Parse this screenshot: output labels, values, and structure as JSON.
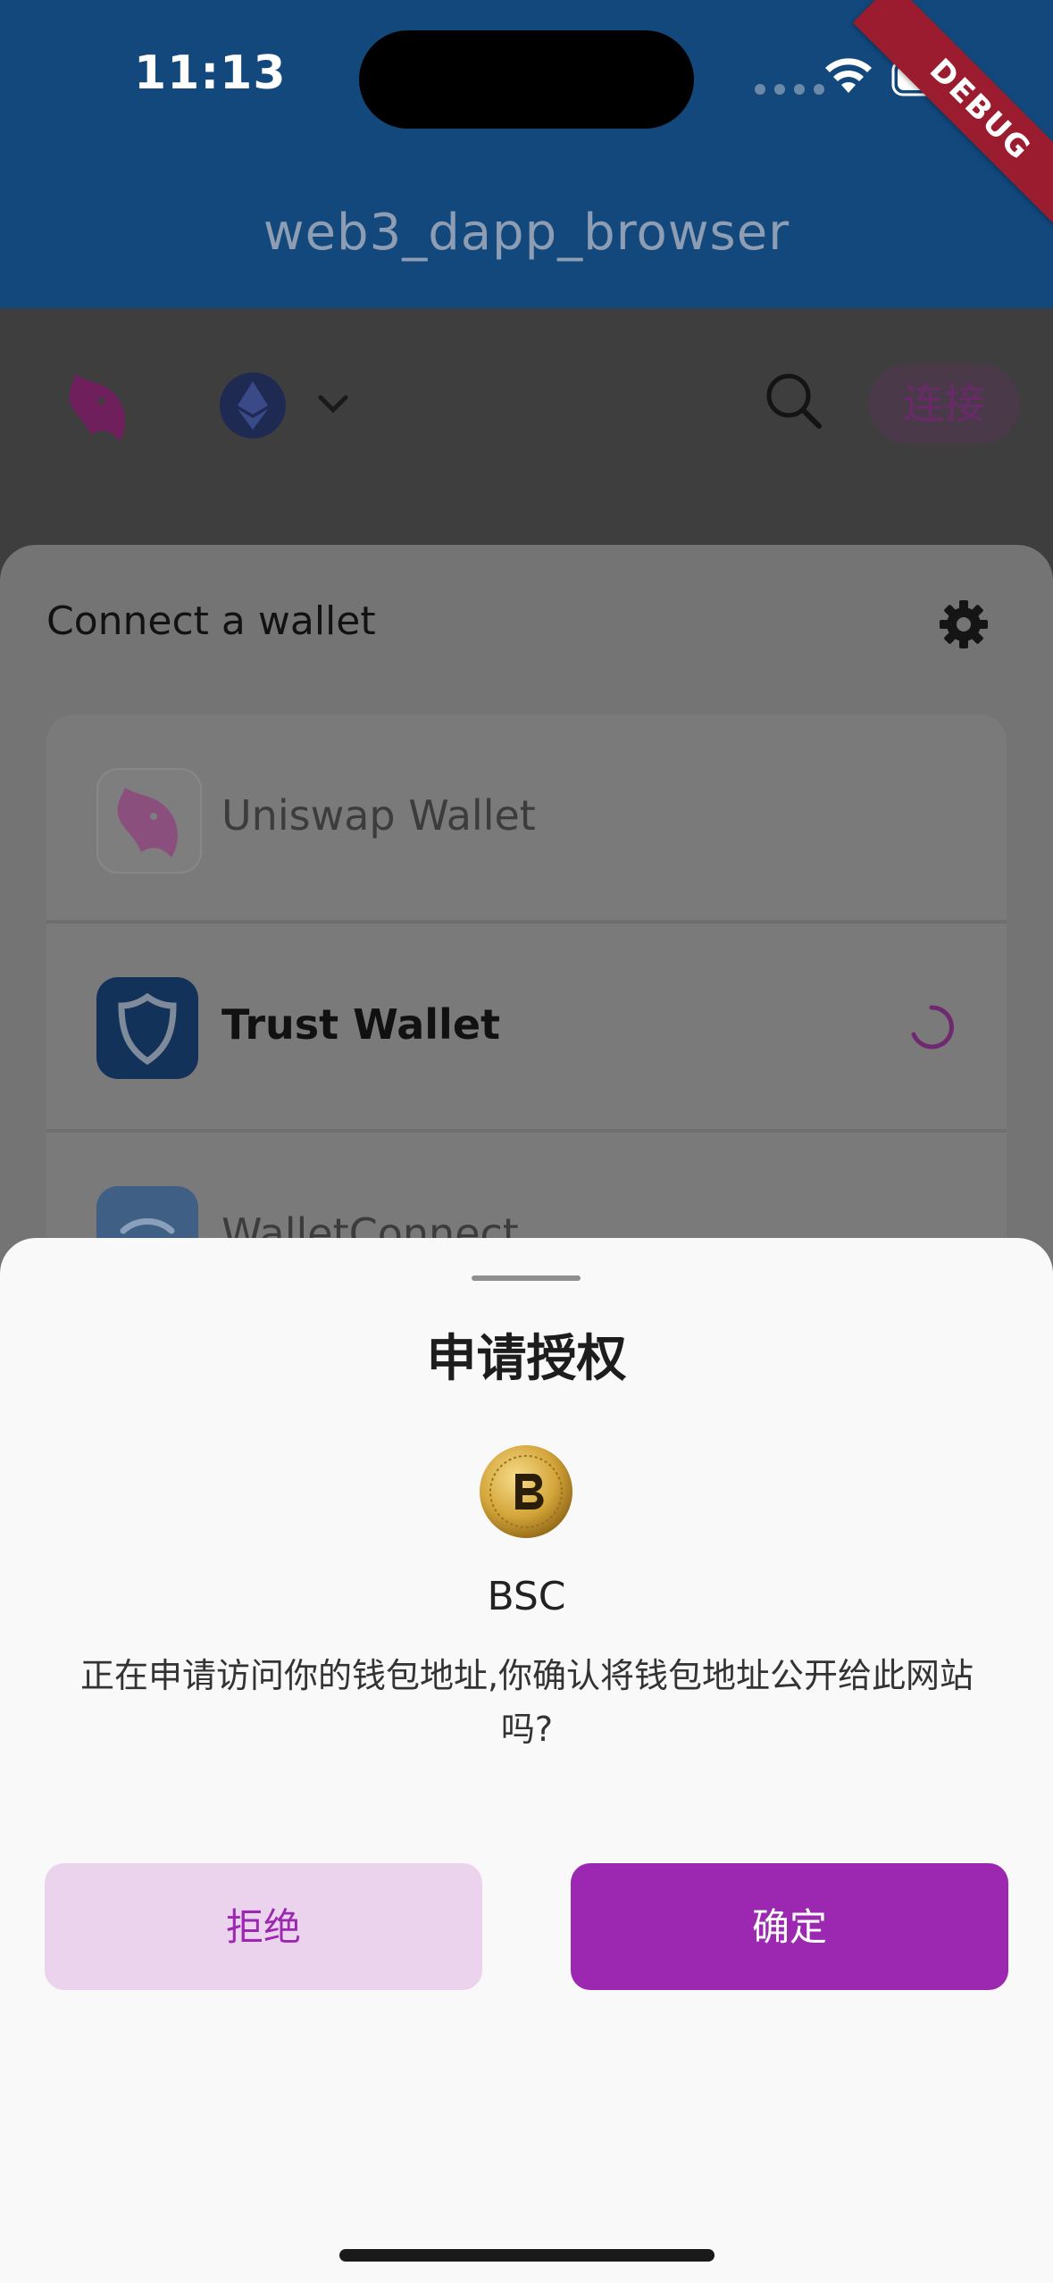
{
  "status_bar": {
    "time": "11:13"
  },
  "debug_banner": "DEBUG",
  "app_bar": {
    "title": "web3_dapp_browser"
  },
  "web_header": {
    "connect_label": "连接"
  },
  "wallet_panel": {
    "title": "Connect a wallet",
    "wallets": [
      {
        "name": "Uniswap Wallet",
        "icon": "uniswap-unicorn-icon"
      },
      {
        "name": "Trust Wallet",
        "icon": "trust-shield-icon",
        "loading": true
      },
      {
        "name": "WalletConnect",
        "icon": "walletconnect-icon"
      }
    ]
  },
  "sheet": {
    "title": "申请授权",
    "coin_name": "BSC",
    "message": "正在申请访问你的钱包地址,你确认将钱包地址公开给此网站吗?",
    "reject_label": "拒绝",
    "confirm_label": "确定"
  },
  "colors": {
    "app_bar": "#13487c",
    "accent": "#9c27b0",
    "reject_bg": "#ebd3ed",
    "overlay": "#3e3e3e",
    "sheet_bg": "#f9f9f9"
  }
}
